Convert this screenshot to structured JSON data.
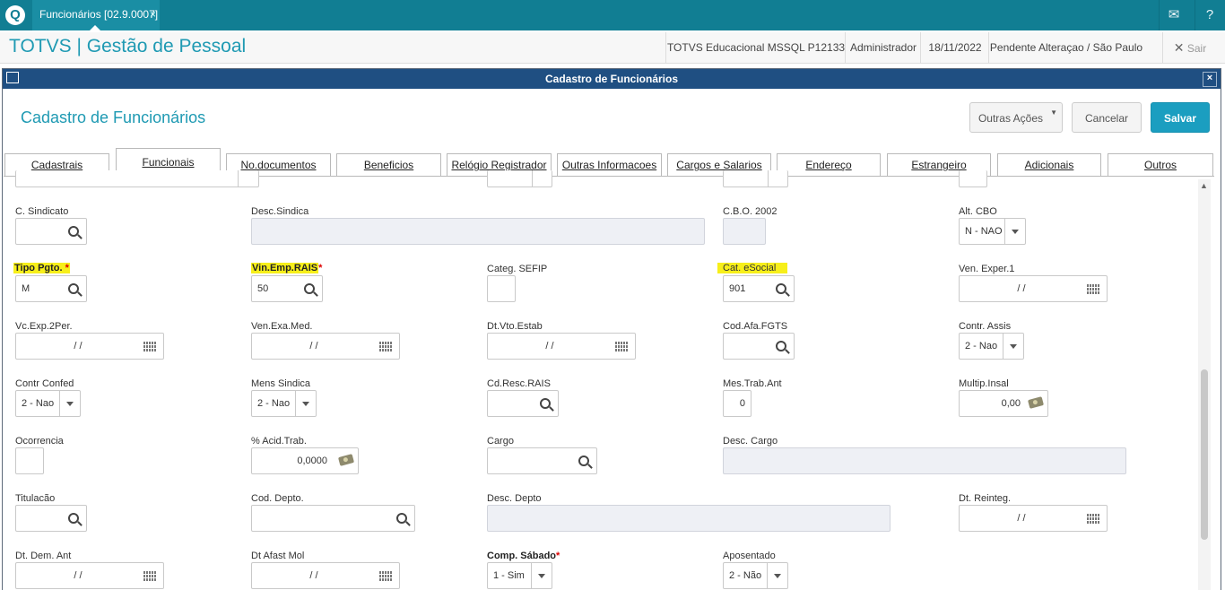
{
  "topbar": {
    "tab_label": "Funcionários [02.9.0007]",
    "tab_close": "×",
    "logo": "Q",
    "mail_icon": "mail-icon",
    "help_icon": "help-icon",
    "mail_glyph": "✉",
    "help_glyph": "?"
  },
  "header": {
    "title": "TOTVS | Gestão de Pessoal",
    "environment": "TOTVS Educacional MSSQL P12133",
    "user": "Administrador",
    "date": "18/11/2022",
    "branch": "Pendente Alteraçao / São Paulo",
    "exit_label": "Sair",
    "exit_glyph": "✕"
  },
  "window": {
    "title": "Cadastro de Funcionários",
    "close_glyph": "×"
  },
  "page": {
    "title": "Cadastro de Funcionários",
    "buttons": {
      "other_actions": "Outras Ações",
      "cancel": "Cancelar",
      "save": "Salvar"
    }
  },
  "tabs": [
    "Cadastrais",
    "Funcionais",
    "No.documentos",
    "Beneficios",
    "Relógio Registrador",
    "Outras Informacoes",
    "Cargos e Salarios",
    "Endereço",
    "Estrangeiro",
    "Adicionais",
    "Outros"
  ],
  "active_tab": "Funcionais",
  "fields": {
    "c_sindicato": {
      "label": "C. Sindicato",
      "value": ""
    },
    "desc_sindica": {
      "label": "Desc.Sindica",
      "value": ""
    },
    "cbo_2002": {
      "label": "C.B.O. 2002",
      "value": ""
    },
    "alt_cbo": {
      "label": "Alt. CBO",
      "value": "N - NAO"
    },
    "tipo_pgto": {
      "label": "Tipo Pgto.",
      "required": "*",
      "value": "M"
    },
    "vin_emp_rais": {
      "label": "Vin.Emp.RAIS",
      "required": "*",
      "value": "50"
    },
    "categ_sefip": {
      "label": "Categ. SEFIP",
      "value": ""
    },
    "cat_esocial": {
      "label": "Cat. eSocial",
      "value": "901"
    },
    "ven_exper_1": {
      "label": "Ven. Exper.1",
      "value": "/ /"
    },
    "vc_exp_2per": {
      "label": "Vc.Exp.2Per.",
      "value": "/ /"
    },
    "ven_exa_med": {
      "label": "Ven.Exa.Med.",
      "value": "/ /"
    },
    "dt_vto_estab": {
      "label": "Dt.Vto.Estab",
      "value": "/ /"
    },
    "cod_afa_fgts": {
      "label": "Cod.Afa.FGTS",
      "value": ""
    },
    "contr_assis": {
      "label": "Contr. Assis",
      "value": "2 - Nao"
    },
    "contr_confed": {
      "label": "Contr Confed",
      "value": "2 - Nao"
    },
    "mens_sindica": {
      "label": "Mens Sindica",
      "value": "2 - Nao"
    },
    "cd_resc_rais": {
      "label": "Cd.Resc.RAIS",
      "value": ""
    },
    "mes_trab_ant": {
      "label": "Mes.Trab.Ant",
      "value": "0"
    },
    "multip_insal": {
      "label": "Multip.Insal",
      "value": "0,00"
    },
    "ocorrencia": {
      "label": "Ocorrencia",
      "value": ""
    },
    "acid_trab": {
      "label": "% Acid.Trab.",
      "value": "0,0000"
    },
    "cargo": {
      "label": "Cargo",
      "value": ""
    },
    "desc_cargo": {
      "label": "Desc. Cargo",
      "value": ""
    },
    "titulacao": {
      "label": "Titulacão",
      "value": ""
    },
    "cod_depto": {
      "label": "Cod. Depto.",
      "value": ""
    },
    "desc_depto": {
      "label": "Desc. Depto",
      "value": ""
    },
    "dt_reinteg": {
      "label": "Dt. Reinteg.",
      "value": "/ /"
    },
    "dt_dem_ant": {
      "label": "Dt. Dem. Ant",
      "value": "/ /"
    },
    "dt_afast_mol": {
      "label": "Dt Afast Mol",
      "value": "/ /"
    },
    "comp_sabado": {
      "label": "Comp. Sábado",
      "required": "*",
      "value": "1 - Sim"
    },
    "aposentado": {
      "label": "Aposentado",
      "value": "2 - Não"
    }
  },
  "colors": {
    "topbar": "#117e93",
    "accent": "#1f9ab3",
    "window_title": "#1f4f82",
    "primary_button": "#1b9ec0",
    "highlight": "#f7ef1a",
    "required": "#dd0000"
  }
}
